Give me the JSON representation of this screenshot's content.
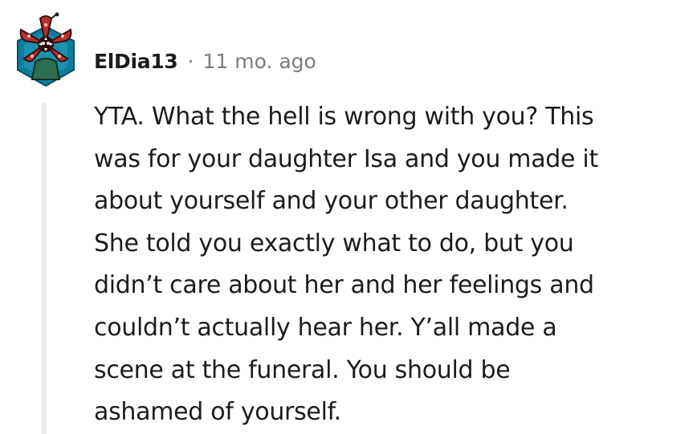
{
  "comment": {
    "author": "ElDia13",
    "separator": "·",
    "timestamp": "11 mo. ago",
    "avatar_icon": "demogorgon-snoo-avatar",
    "body_lines": [
      "YTA. What the hell is wrong with you? This",
      "was for your daughter Isa and you made it",
      "about yourself and your other daughter.",
      "She told you exactly what to do, but you",
      "didn’t care about her and her feelings and",
      "couldn’t actually hear her. Y’all made a",
      "scene at the funeral. You should be",
      "ashamed of yourself."
    ]
  },
  "colors": {
    "text": "#1c1c1c",
    "meta": "#7c7c7c",
    "thread_line": "#e9e9e9",
    "avatar_bg": "#0e7d9c",
    "avatar_red": "#b8312f"
  }
}
